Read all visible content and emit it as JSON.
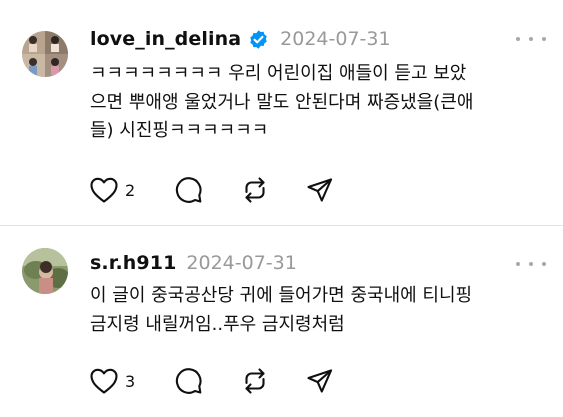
{
  "posts": [
    {
      "username": "love_in_delina",
      "verified": true,
      "timestamp": "2024-07-31",
      "avatar": "avatar-collage",
      "lines": [
        "ㅋㅋㅋㅋㅋㅋㅋㅋ 우리 어린이집 애들이 듣고 보았",
        "으면 뿌애앵 울었거나 말도 안된다며 짜증냈을(큰애",
        "들) 시진핑ㅋㅋㅋㅋㅋㅋ"
      ],
      "like_count": "2",
      "icons": [
        "heart-icon",
        "comment-icon",
        "repost-icon",
        "share-icon"
      ]
    },
    {
      "username": "s.r.h911",
      "verified": false,
      "timestamp": "2024-07-31",
      "avatar": "avatar-photo",
      "lines": [
        "이 글이 중국공산당 귀에 들어가면 중국내에 티니핑",
        "금지령 내릴꺼임..푸우 금지령처럼"
      ],
      "like_count": "3",
      "icons": [
        "heart-icon",
        "comment-icon",
        "repost-icon",
        "share-icon"
      ]
    }
  ],
  "colors": {
    "text": "#101010",
    "muted": "#999999",
    "verified": "#0095f6",
    "divider": "#e3e3e3"
  }
}
